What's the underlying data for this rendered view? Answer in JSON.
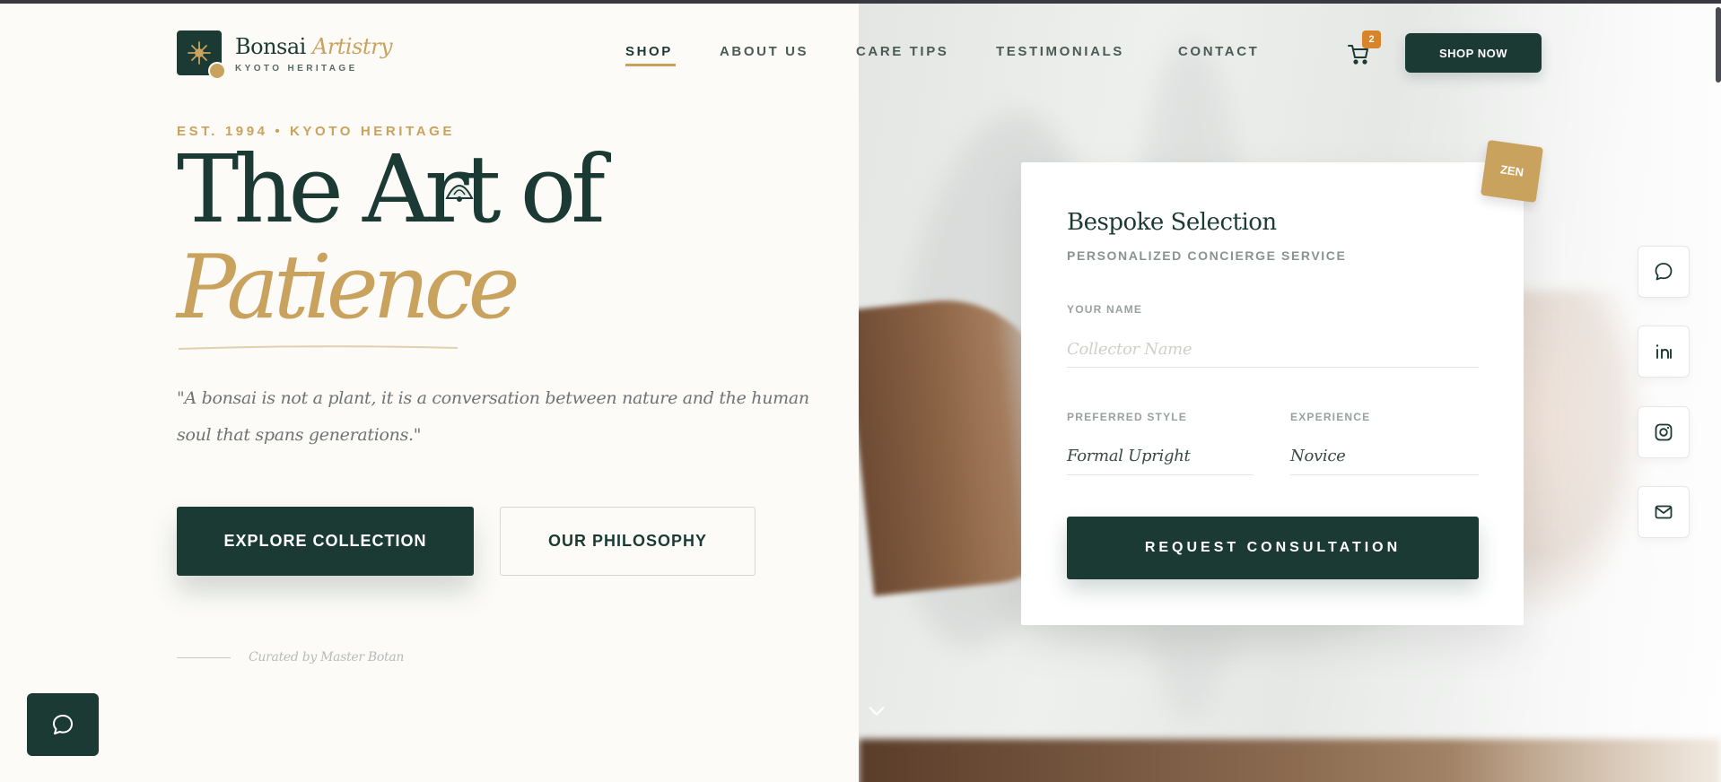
{
  "brand": {
    "name_main": "Bonsai",
    "name_accent": "Artistry",
    "tagline": "KYOTO HERITAGE",
    "logo_icon": "bonsai-tree-icon"
  },
  "nav": {
    "items": [
      {
        "label": "SHOP",
        "active": true
      },
      {
        "label": "ABOUT US",
        "active": false
      },
      {
        "label": "CARE TIPS",
        "active": false
      },
      {
        "label": "TESTIMONIALS",
        "active": false
      },
      {
        "label": "CONTACT",
        "active": false
      }
    ],
    "cart_count": "2",
    "cart_icon": "cart-icon",
    "shop_now_label": "SHOP NOW"
  },
  "hero": {
    "eyebrow": "EST. 1994 • KYOTO HERITAGE",
    "title_line1": "The Art of",
    "title_line2": "Patience",
    "quote": "\"A bonsai is not a plant, it is a conversation between nature and the human soul that spans generations.\"",
    "primary_cta": "EXPLORE COLLECTION",
    "secondary_cta": "OUR PHILOSOPHY",
    "curator": "Curated by Master Botan"
  },
  "form": {
    "badge": "ZEN",
    "title": "Bespoke Selection",
    "subtitle": "PERSONALIZED CONCIERGE SERVICE",
    "name_label": "YOUR NAME",
    "name_placeholder": "Collector Name",
    "name_value": "",
    "style_label": "PREFERRED STYLE",
    "style_value": "Formal Upright",
    "experience_label": "EXPERIENCE",
    "experience_value": "Novice",
    "submit_label": "REQUEST CONSULTATION"
  },
  "social": [
    "chat-icon",
    "linkedin-icon",
    "instagram-icon",
    "mail-icon"
  ],
  "colors": {
    "primary": "#1b3a33",
    "accent_gold": "#c9a25e",
    "badge_orange": "#d8842a",
    "background": "#fcfbf8"
  }
}
